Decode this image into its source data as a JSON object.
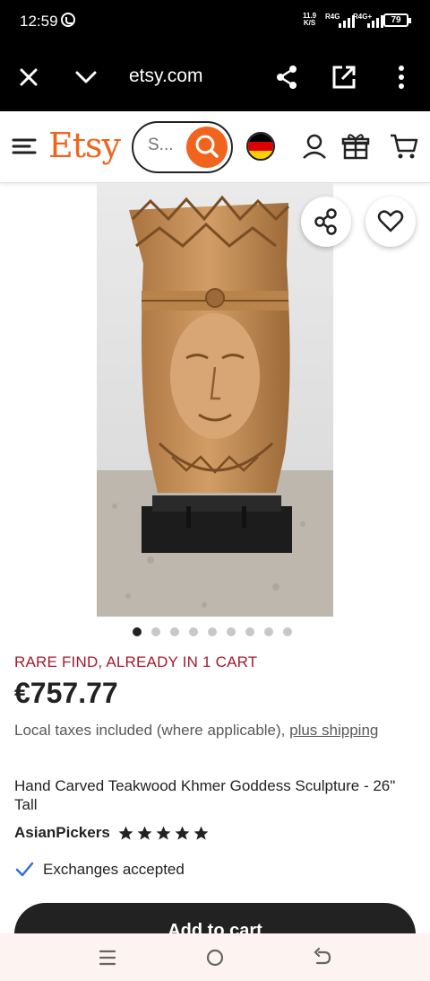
{
  "status_bar": {
    "time": "12:59",
    "net_speed_top": "11.9",
    "net_speed_bottom": "K/S",
    "sim1": "R4G",
    "sim2": "R4G+",
    "battery": "79"
  },
  "browser": {
    "url": "etsy.com",
    "icons": [
      "close-icon",
      "chevron-down-icon",
      "share-icon",
      "open-external-icon",
      "more-vertical-icon"
    ]
  },
  "header": {
    "logo": "Etsy",
    "search_placeholder": "S...",
    "icons": [
      "menu-icon",
      "search-icon",
      "german-flag-icon",
      "account-icon",
      "gift-icon",
      "cart-icon"
    ]
  },
  "product": {
    "image_alt": "Hand carved teakwood Khmer goddess head on black stand",
    "carousel_count": 9,
    "carousel_active": 0,
    "badge": "RARE FIND, ALREADY IN 1 CART",
    "price": "€757.77",
    "taxes_text": "Local taxes included (where applicable), ",
    "taxes_link": "plus shipping",
    "title": "Hand Carved Teakwood Khmer Goddess Sculpture - 26\" Tall",
    "shop_name": "AsianPickers",
    "rating": 5,
    "exchanges": "Exchanges accepted",
    "cta": "Add to cart"
  },
  "colors": {
    "brand": "#f1641e",
    "badge": "#a61a2e",
    "check": "#2f6fd6"
  }
}
